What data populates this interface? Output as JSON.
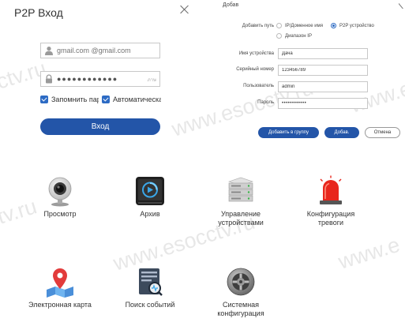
{
  "login": {
    "title": "P2P Вход",
    "username_placeholder": "gmail.com @gmail.com",
    "password_value": "●●●●●●●●●●●●",
    "lang_hint": "ภาษ",
    "remember_label": "Запомнить пар",
    "auto_label": "Автоматическая",
    "login_button": "Вход"
  },
  "add_device": {
    "title": "Добав",
    "path_label": "Добавить путь",
    "radio_ip": "IP/Доменное имя",
    "radio_p2p": "P2P устройство",
    "radio_range": "Диапазон IP",
    "selected_radio": "radio_p2p",
    "name_label": "Имя устройства",
    "name_value": "Дача",
    "serial_label": "Серийный номер",
    "serial_value": "123456789",
    "user_label": "Пользователь",
    "user_value": "admin",
    "pass_label": "Пароль",
    "pass_value": "••••••••••••",
    "add_to_group_button": "Добавить в группу",
    "add_button": "Добав.",
    "cancel_button": "Отмена"
  },
  "modules": {
    "preview": "Просмотр",
    "archive": "Архив",
    "devices_line1": "Управление",
    "devices_line2": "устройствами",
    "alarm_line1": "Конфигурация",
    "alarm_line2": "тревоги",
    "emap": "Электронная карта",
    "events": "Поиск событий",
    "syscfg_line1": "Системная",
    "syscfg_line2": "конфигурация"
  },
  "watermark": {
    "a": "ctv.ru",
    "b": "www.esocctv.ru",
    "c": "www.e"
  },
  "colors": {
    "accent": "#2355a8",
    "alarm_red": "#e8261d"
  }
}
